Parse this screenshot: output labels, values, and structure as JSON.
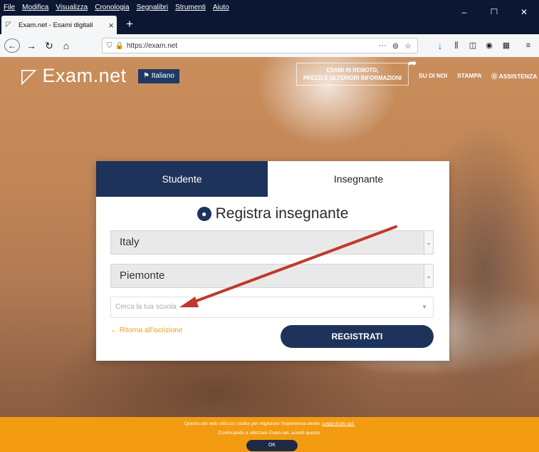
{
  "browser": {
    "menu": [
      "File",
      "Modifica",
      "Visualizza",
      "Cronologia",
      "Segnalibri",
      "Strumenti",
      "Aiuto"
    ],
    "tab_title": "Exam.net - Esami digitali",
    "url": "https://exam.net",
    "window_controls": {
      "minimize": "–",
      "maximize": "☐",
      "close": "✕"
    }
  },
  "site": {
    "logo": "Exam.net",
    "language": "Italiano",
    "promo_line1": "ESAMI IN REMOTO,",
    "promo_line2": "PREZZI E ULTERIORI INFORMAZIONI",
    "nav": {
      "about": "SU DI NOI",
      "print": "STAMPA",
      "help": "ASSISTENZA"
    }
  },
  "card": {
    "tab_student": "Studente",
    "tab_teacher": "Insegnante",
    "title": "Registra insegnante",
    "country": "Italy",
    "region": "Piemonte",
    "school_placeholder": "Cerca la tua scuola",
    "back_link": "Ritorna all'iscrizione",
    "register_button": "REGISTRATI"
  },
  "cookie": {
    "line1": "Questo sito web utilizza i cookie per migliorare l'esperienza utente.",
    "link": "Leggi di più qui.",
    "line2": "Continuando a utilizzare Exam.net, accetti questo.",
    "ok": "OK"
  },
  "annotation": {
    "arrow_color": "#c0392b"
  }
}
